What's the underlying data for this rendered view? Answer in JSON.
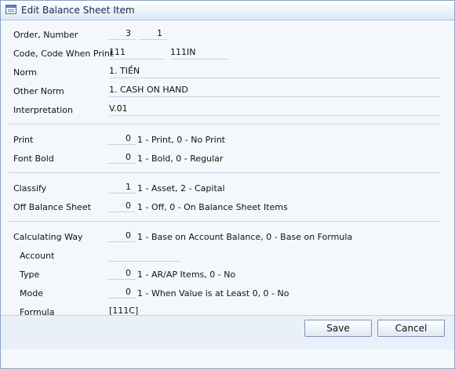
{
  "window": {
    "title": "Edit Balance Sheet Item"
  },
  "form": {
    "order_number": {
      "label": "Order, Number",
      "order": "3",
      "number": "1"
    },
    "code": {
      "label": "Code, Code When Print",
      "code": "111",
      "code_when_print": "111IN"
    },
    "norm": {
      "label": "Norm",
      "value": "1. TIỀN"
    },
    "other_norm": {
      "label": "Other Norm",
      "value": "1. CASH ON HAND"
    },
    "interpretation": {
      "label": "Interpretation",
      "value": "V.01"
    },
    "print": {
      "label": "Print",
      "value": "0",
      "hint": "1 - Print, 0 - No Print"
    },
    "font_bold": {
      "label": "Font Bold",
      "value": "0",
      "hint": "1 - Bold, 0 - Regular"
    },
    "classify": {
      "label": "Classify",
      "value": "1",
      "hint": "1 - Asset, 2 - Capital"
    },
    "off_balance": {
      "label": "Off Balance Sheet",
      "value": "0",
      "hint": "1 - Off, 0 - On Balance Sheet Items"
    },
    "calculating_way": {
      "label": "Calculating Way",
      "value": "0",
      "hint": "1 - Base on Account Balance, 0 - Base on Formula"
    },
    "account": {
      "label": "Account",
      "value": ""
    },
    "type": {
      "label": "Type",
      "value": "0",
      "hint": "1 - AR/AP Items, 0 - No"
    },
    "mode": {
      "label": "Mode",
      "value": "0",
      "hint": "1 - When Value is at Least 0, 0 - No"
    },
    "formula": {
      "label": "Formula",
      "value": "[111C]"
    }
  },
  "buttons": {
    "save": "Save",
    "cancel": "Cancel"
  },
  "icons": {
    "title": "form-window-icon"
  }
}
